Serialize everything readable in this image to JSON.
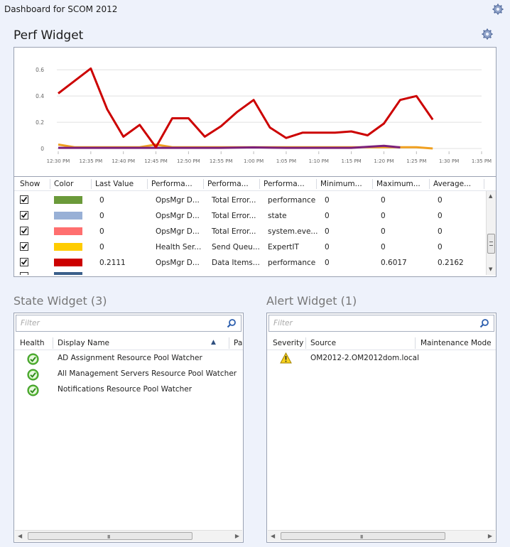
{
  "header": {
    "title": "Dashboard for SCOM 2012",
    "settings_icon": "gear-icon"
  },
  "perf_widget": {
    "title": "Perf Widget",
    "settings_icon": "gear-icon",
    "columns": [
      "Show",
      "Color",
      "Last Value",
      "Performa...",
      "Performa...",
      "Performa...",
      "Minimum...",
      "Maximum...",
      "Average..."
    ],
    "rows": [
      {
        "show": true,
        "color": "#6b9a3a",
        "last": "0",
        "p1": "OpsMgr D...",
        "p2": "Total Error...",
        "p3": "performance",
        "min": "0",
        "max": "0",
        "avg": "0"
      },
      {
        "show": true,
        "color": "#98b0d6",
        "last": "0",
        "p1": "OpsMgr D...",
        "p2": "Total Error...",
        "p3": "state",
        "min": "0",
        "max": "0",
        "avg": "0"
      },
      {
        "show": true,
        "color": "#ff6f6f",
        "last": "0",
        "p1": "OpsMgr D...",
        "p2": "Total Error...",
        "p3": "system.eve...",
        "min": "0",
        "max": "0",
        "avg": "0"
      },
      {
        "show": true,
        "color": "#ffcc00",
        "last": "0",
        "p1": "Health Ser...",
        "p2": "Send Queu...",
        "p3": "ExpertIT",
        "min": "0",
        "max": "0",
        "avg": "0"
      },
      {
        "show": true,
        "color": "#cc0000",
        "last": "0.2111",
        "p1": "OpsMgr D...",
        "p2": "Data Items...",
        "p3": "performance",
        "min": "0",
        "max": "0.6017",
        "avg": "0.2162"
      }
    ]
  },
  "chart_data": {
    "type": "line",
    "x": [
      "12:30 PM",
      "12:35 PM",
      "12:40 PM",
      "12:45 PM",
      "12:50 PM",
      "12:55 PM",
      "1:00 PM",
      "1:05 PM",
      "1:10 PM",
      "1:15 PM",
      "1:20 PM",
      "1:25 PM",
      "1:30 PM",
      "1:35 PM"
    ],
    "yticks": [
      "0",
      "0.2",
      "0.4",
      "0.6"
    ],
    "ylim": [
      0,
      0.65
    ],
    "grid": true,
    "series": [
      {
        "color": "#cc0000",
        "points": [
          [
            0,
            0.42
          ],
          [
            1,
            0.61
          ],
          [
            1.5,
            0.3
          ],
          [
            2,
            0.09
          ],
          [
            2.5,
            0.18
          ],
          [
            3,
            0.01
          ],
          [
            3.5,
            0.23
          ],
          [
            4,
            0.23
          ],
          [
            4.5,
            0.09
          ],
          [
            5,
            0.17
          ],
          [
            5.5,
            0.28
          ],
          [
            6,
            0.37
          ],
          [
            6.5,
            0.16
          ],
          [
            7,
            0.08
          ],
          [
            7.5,
            0.12
          ],
          [
            8,
            0.12
          ],
          [
            8.5,
            0.12
          ],
          [
            9,
            0.13
          ],
          [
            9.5,
            0.1
          ],
          [
            10,
            0.19
          ],
          [
            10.5,
            0.37
          ],
          [
            11,
            0.4
          ],
          [
            11.5,
            0.22
          ]
        ]
      },
      {
        "color": "#f0a020",
        "points": [
          [
            0,
            0.03
          ],
          [
            0.5,
            0.01
          ],
          [
            2.5,
            0.01
          ],
          [
            3,
            0.03
          ],
          [
            3.5,
            0.01
          ],
          [
            10.5,
            0.01
          ],
          [
            11,
            0.01
          ],
          [
            11.5,
            0.0
          ]
        ]
      },
      {
        "color": "#7b1f7b",
        "points": [
          [
            0,
            0.005
          ],
          [
            5,
            0.005
          ],
          [
            6,
            0.008
          ],
          [
            7,
            0.005
          ],
          [
            9,
            0.005
          ],
          [
            10,
            0.02
          ],
          [
            10.5,
            0.008
          ]
        ]
      }
    ]
  },
  "state_widget": {
    "title": "State Widget (3)",
    "filter_placeholder": "Filter",
    "columns": [
      "Health",
      "Display Name",
      "Pa"
    ],
    "rows": [
      {
        "name": "AD Assignment Resource Pool Watcher"
      },
      {
        "name": "All Management Servers Resource Pool Watcher"
      },
      {
        "name": "Notifications Resource Pool Watcher"
      }
    ]
  },
  "alert_widget": {
    "title": "Alert Widget (1)",
    "filter_placeholder": "Filter",
    "columns": [
      "Severity",
      "Source",
      "Maintenance Mode"
    ],
    "rows": [
      {
        "source": "OM2012-2.OM2012dom.local"
      }
    ]
  },
  "scroll": {
    "grip": "III"
  }
}
